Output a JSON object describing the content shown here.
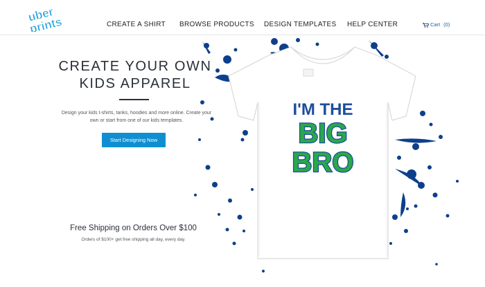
{
  "brand": {
    "logo_text_top": "uber",
    "logo_text_bottom": "prints",
    "color": "#1ba0dc"
  },
  "nav": {
    "items": [
      {
        "label": "CREATE A SHIRT"
      },
      {
        "label": "BROWSE PRODUCTS"
      },
      {
        "label": "DESIGN TEMPLATES"
      },
      {
        "label": "HELP CENTER"
      }
    ],
    "cart": {
      "label": "Cart",
      "count": "(0)",
      "icon": "cart-icon"
    }
  },
  "hero": {
    "title_line1": "CREATE YOUR OWN",
    "title_line2": "KIDS APPAREL",
    "subtitle": "Design your kids t-shirts, tanks, hoodies and more online. Create your own or start from one of our kids templates.",
    "cta_label": "Start Designing Now",
    "cta_color": "#0f8fd1"
  },
  "shipping": {
    "title": "Free Shipping on Orders Over $100",
    "subtitle": "Orders of $100+ get free shipping all day, every day."
  },
  "shirt": {
    "line1": "I'M THE",
    "line2": "BIG",
    "line3": "BRO",
    "text_blue": "#1e4d9c",
    "text_green": "#2aa84a",
    "splatter_color": "#0d3f8c"
  }
}
